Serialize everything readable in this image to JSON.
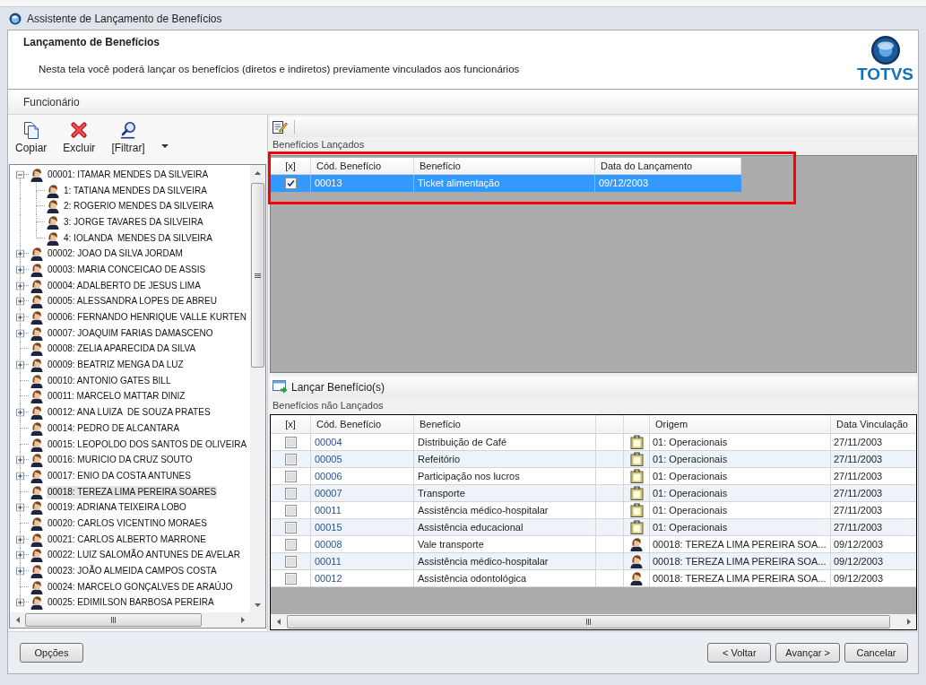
{
  "window": {
    "title": "Assistente de Lançamento de Benefícios"
  },
  "header": {
    "title": "Lançamento de Benefícios",
    "description": "Nesta tela você poderá lançar os benefícios (diretos e indiretos) previamente vinculados aos funcionários",
    "logo_text": "TOTVS"
  },
  "section_label": "Funcionário",
  "employee_toolbar": [
    {
      "label": "Copiar",
      "kind": "copy"
    },
    {
      "label": "Excluir",
      "kind": "delete"
    },
    {
      "label": "[Filtrar]",
      "kind": "filter"
    }
  ],
  "employee_tree": [
    {
      "label": "00001: ITAMAR MENDES DA SILVEIRA",
      "expandable": true,
      "expanded": true,
      "selected": false,
      "children": [
        {
          "label": "1: TATIANA MENDES DA SILVEIRA",
          "expandable": false,
          "selected": false
        },
        {
          "label": "2: ROGERIO MENDES DA SILVEIRA",
          "expandable": false,
          "selected": false
        },
        {
          "label": "3: JORGE TAVARES DA SILVEIRA",
          "expandable": false,
          "selected": false
        },
        {
          "label": "4: IOLANDA  MENDES DA SILVEIRA",
          "expandable": false,
          "selected": false
        }
      ]
    },
    {
      "label": "00002: JOAO DA SILVA JORDAM",
      "expandable": true,
      "expanded": false,
      "selected": false
    },
    {
      "label": "00003: MARIA CONCEICAO DE ASSIS",
      "expandable": true,
      "expanded": false,
      "selected": false
    },
    {
      "label": "00004: ADALBERTO DE JESUS LIMA",
      "expandable": true,
      "expanded": false,
      "selected": false
    },
    {
      "label": "00005: ALESSANDRA LOPES DE ABREU",
      "expandable": true,
      "expanded": false,
      "selected": false
    },
    {
      "label": "00006: FERNANDO HENRIQUE VALLE KURTEN",
      "expandable": true,
      "expanded": false,
      "selected": false
    },
    {
      "label": "00007: JOAQUIM FARIAS DAMASCENO",
      "expandable": true,
      "expanded": false,
      "selected": false
    },
    {
      "label": "00008: ZELIA APARECIDA DA SILVA",
      "expandable": false,
      "selected": false
    },
    {
      "label": "00009: BEATRIZ MENGA DA LUZ",
      "expandable": true,
      "expanded": false,
      "selected": false
    },
    {
      "label": "00010: ANTONIO GATES BILL",
      "expandable": false,
      "selected": false
    },
    {
      "label": "00011: MARCELO MATTAR DINIZ",
      "expandable": false,
      "selected": false
    },
    {
      "label": "00012: ANA LUIZA  DE SOUZA PRATES",
      "expandable": true,
      "expanded": false,
      "selected": false
    },
    {
      "label": "00014: PEDRO DE ALCANTARA",
      "expandable": false,
      "selected": false
    },
    {
      "label": "00015: LEOPOLDO DOS SANTOS DE OLIVEIRA",
      "expandable": false,
      "selected": false
    },
    {
      "label": "00016: MURICIO DA CRUZ SOUTO",
      "expandable": true,
      "expanded": false,
      "selected": false
    },
    {
      "label": "00017: ENIO DA COSTA ANTUNES",
      "expandable": true,
      "expanded": false,
      "selected": false
    },
    {
      "label": "00018: TEREZA LIMA PEREIRA SOARES",
      "expandable": false,
      "selected": true
    },
    {
      "label": "00019: ADRIANA TEIXEIRA LOBO",
      "expandable": true,
      "expanded": false,
      "selected": false
    },
    {
      "label": "00020: CARLOS VICENTINO MORAES",
      "expandable": false,
      "selected": false
    },
    {
      "label": "00021: CARLOS ALBERTO MARRONE",
      "expandable": true,
      "expanded": false,
      "selected": false
    },
    {
      "label": "00022: LUIZ SALOMÃO ANTUNES DE AVELAR",
      "expandable": true,
      "expanded": false,
      "selected": false
    },
    {
      "label": "00023: JOÃO ALMEIDA CAMPOS COSTA",
      "expandable": true,
      "expanded": false,
      "selected": false
    },
    {
      "label": "00024: MARCELO GONÇALVES DE ARAÚJO",
      "expandable": false,
      "selected": false
    },
    {
      "label": "00025: EDIMILSON BARBOSA PEREIRA",
      "expandable": true,
      "expanded": false,
      "selected": false
    }
  ],
  "launched": {
    "title": "Benefícios Lançados",
    "highlighted": true,
    "columns": [
      "[x]",
      "Cód. Benefício",
      "Benefício",
      "Data do Lançamento"
    ],
    "rows": [
      {
        "checked": true,
        "selected": true,
        "code": "00013",
        "benefit": "Ticket alimentação",
        "date": "09/12/2003"
      }
    ]
  },
  "launch_button": "Lançar Benefício(s)",
  "not_launched": {
    "title": "Benefícios não Lançados",
    "columns": [
      "[x]",
      "Cód. Benefício",
      "Benefício",
      "Origem",
      "Data Vinculação"
    ],
    "rows": [
      {
        "checked": false,
        "code": "00004",
        "benefit": "Distribuição de Café",
        "kind": "group",
        "origin": "01: Operacionais",
        "date": "27/11/2003"
      },
      {
        "checked": false,
        "code": "00005",
        "benefit": "Refeitório",
        "kind": "group",
        "origin": "01: Operacionais",
        "date": "27/11/2003"
      },
      {
        "checked": false,
        "code": "00006",
        "benefit": "Participação nos lucros",
        "kind": "group",
        "origin": "01: Operacionais",
        "date": "27/11/2003"
      },
      {
        "checked": false,
        "code": "00007",
        "benefit": "Transporte",
        "kind": "group",
        "origin": "01: Operacionais",
        "date": "27/11/2003"
      },
      {
        "checked": false,
        "code": "00011",
        "benefit": "Assistência médico-hospitalar",
        "kind": "group",
        "origin": "01: Operacionais",
        "date": "27/11/2003"
      },
      {
        "checked": false,
        "code": "00015",
        "benefit": "Assistência educacional",
        "kind": "group",
        "origin": "01: Operacionais",
        "date": "27/11/2003"
      },
      {
        "checked": false,
        "code": "00008",
        "benefit": "Vale transporte",
        "kind": "employee",
        "origin": "00018: TEREZA LIMA PEREIRA SOA...",
        "date": "09/12/2003"
      },
      {
        "checked": false,
        "code": "00011",
        "benefit": "Assistência médico-hospitalar",
        "kind": "employee",
        "origin": "00018: TEREZA LIMA PEREIRA SOA...",
        "date": "09/12/2003"
      },
      {
        "checked": false,
        "code": "00012",
        "benefit": "Assistência odontológica",
        "kind": "employee",
        "origin": "00018: TEREZA LIMA PEREIRA SOA...",
        "date": "09/12/2003"
      }
    ]
  },
  "footer": {
    "left_buttons": [
      "Opções"
    ],
    "right_buttons": [
      "< Voltar",
      "Avançar >",
      "Cancelar"
    ]
  }
}
